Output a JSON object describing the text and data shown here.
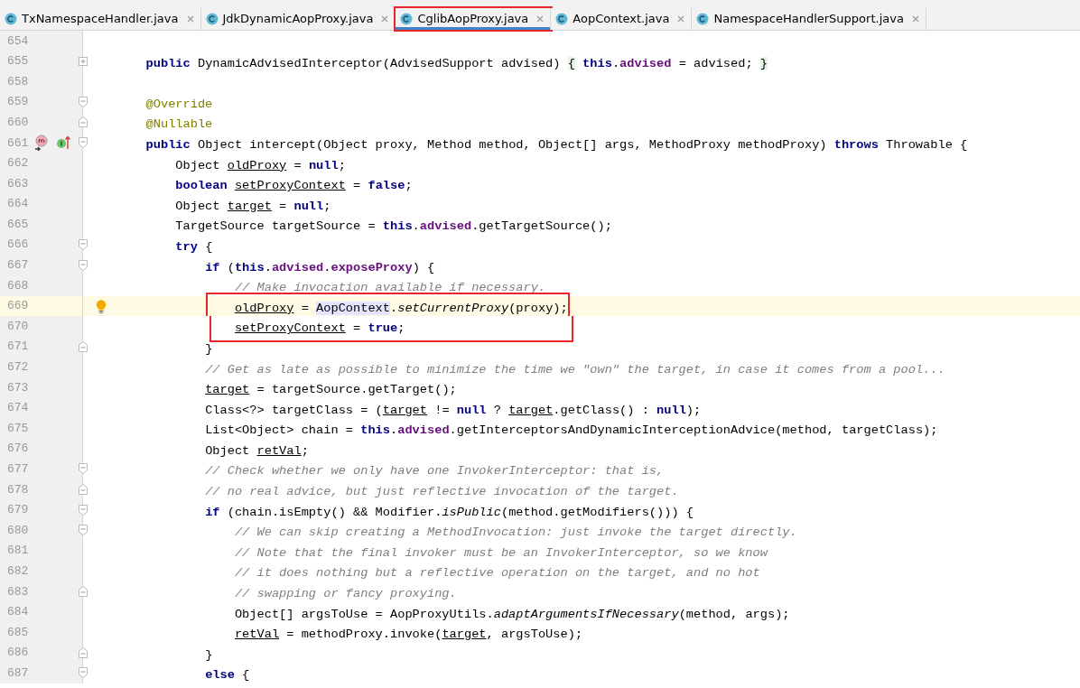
{
  "tabs": [
    {
      "label": "TxNamespaceHandler.java",
      "selected": false,
      "boxed": false
    },
    {
      "label": "JdkDynamicAopProxy.java",
      "selected": false,
      "boxed": false
    },
    {
      "label": "CglibAopProxy.java",
      "selected": true,
      "boxed": true
    },
    {
      "label": "AopContext.java",
      "selected": false,
      "boxed": false
    },
    {
      "label": "NamespaceHandlerSupport.java",
      "selected": false,
      "boxed": false
    }
  ],
  "editor": {
    "lines": [
      {
        "number": "654",
        "current": false,
        "boxed": false
      },
      {
        "number": "655",
        "current": false,
        "boxed": false,
        "gutter_icons": [
          {
            "kind": "collapsed"
          }
        ],
        "tokens": [
          {
            "kind": "keyword",
            "text": "        public"
          },
          {
            "kind": "plain",
            "text": " DynamicAdvisedInterceptor(AdvisedSupport advised) "
          },
          {
            "kind": "fold_brace",
            "text": "{"
          },
          {
            "kind": "keyword",
            "text": " this"
          },
          {
            "kind": "plain",
            "text": "."
          },
          {
            "kind": "field",
            "text": "advised"
          },
          {
            "kind": "plain",
            "text": " = advised; "
          },
          {
            "kind": "fold_brace",
            "text": "}"
          }
        ]
      },
      {
        "number": "658",
        "current": false,
        "boxed": false
      },
      {
        "number": "659",
        "current": false,
        "boxed": false,
        "gutter_icons": [
          {
            "kind": "fold_start"
          }
        ],
        "tokens": [
          {
            "kind": "annotation",
            "text": "        @Override"
          }
        ]
      },
      {
        "number": "660",
        "current": false,
        "boxed": false,
        "gutter_icons": [
          {
            "kind": "fold_end"
          }
        ],
        "tokens": [
          {
            "kind": "annotation",
            "text": "        @Nullable"
          }
        ]
      },
      {
        "number": "661",
        "current": false,
        "boxed": false,
        "gutter_icons": [
          {
            "kind": "method"
          },
          {
            "kind": "implements"
          },
          {
            "kind": "fold_start"
          }
        ],
        "tokens": [
          {
            "kind": "keyword",
            "text": "        public"
          },
          {
            "kind": "plain",
            "text": " Object intercept(Object proxy, Method method, Object[] args, MethodProxy methodProxy) "
          },
          {
            "kind": "keyword",
            "text": "throws"
          },
          {
            "kind": "plain",
            "text": " Throwable {"
          }
        ]
      },
      {
        "number": "662",
        "current": false,
        "boxed": false,
        "tokens": [
          {
            "kind": "plain",
            "text": "            Object "
          },
          {
            "kind": "local",
            "text": "oldProxy"
          },
          {
            "kind": "plain",
            "text": " = "
          },
          {
            "kind": "keyword",
            "text": "null"
          },
          {
            "kind": "plain",
            "text": ";"
          }
        ]
      },
      {
        "number": "663",
        "current": false,
        "boxed": false,
        "tokens": [
          {
            "kind": "keyword",
            "text": "            boolean "
          },
          {
            "kind": "local",
            "text": "setProxyContext"
          },
          {
            "kind": "plain",
            "text": " = "
          },
          {
            "kind": "keyword",
            "text": "false"
          },
          {
            "kind": "plain",
            "text": ";"
          }
        ]
      },
      {
        "number": "664",
        "current": false,
        "boxed": false,
        "tokens": [
          {
            "kind": "plain",
            "text": "            Object "
          },
          {
            "kind": "local",
            "text": "target"
          },
          {
            "kind": "plain",
            "text": " = "
          },
          {
            "kind": "keyword",
            "text": "null"
          },
          {
            "kind": "plain",
            "text": ";"
          }
        ]
      },
      {
        "number": "665",
        "current": false,
        "boxed": false,
        "tokens": [
          {
            "kind": "plain",
            "text": "            TargetSource targetSource = "
          },
          {
            "kind": "keyword",
            "text": "this"
          },
          {
            "kind": "plain",
            "text": "."
          },
          {
            "kind": "field",
            "text": "advised"
          },
          {
            "kind": "plain",
            "text": ".getTargetSource();"
          }
        ]
      },
      {
        "number": "666",
        "current": false,
        "boxed": false,
        "gutter_icons": [
          {
            "kind": "fold_start"
          }
        ],
        "tokens": [
          {
            "kind": "keyword",
            "text": "            try"
          },
          {
            "kind": "plain",
            "text": " {"
          }
        ]
      },
      {
        "number": "667",
        "current": false,
        "boxed": false,
        "gutter_icons": [
          {
            "kind": "fold_start"
          }
        ],
        "tokens": [
          {
            "kind": "keyword",
            "text": "                if"
          },
          {
            "kind": "plain",
            "text": " ("
          },
          {
            "kind": "keyword",
            "text": "this"
          },
          {
            "kind": "plain",
            "text": "."
          },
          {
            "kind": "field",
            "text": "advised"
          },
          {
            "kind": "plain",
            "text": "."
          },
          {
            "kind": "field",
            "text": "exposeProxy"
          },
          {
            "kind": "plain",
            "text": ") {"
          }
        ]
      },
      {
        "number": "668",
        "current": false,
        "boxed": false,
        "tokens": [
          {
            "kind": "comment",
            "text": "                    // Make invocation available if necessary."
          }
        ]
      },
      {
        "number": "669",
        "current": true,
        "boxed": true,
        "gutter_icons": [
          {
            "kind": "bulb"
          }
        ],
        "tokens": [
          {
            "kind": "local",
            "text": "                    oldProxy"
          },
          {
            "kind": "plain",
            "text": " = "
          },
          {
            "kind": "usage",
            "text": "AopContext"
          },
          {
            "kind": "plain",
            "text": "."
          },
          {
            "kind": "static",
            "text": "setCurrentProxy"
          },
          {
            "kind": "plain",
            "text": "(proxy);"
          }
        ]
      },
      {
        "number": "670",
        "current": false,
        "boxed": true,
        "tokens": [
          {
            "kind": "local",
            "text": "                    setProxyContext"
          },
          {
            "kind": "plain",
            "text": " = "
          },
          {
            "kind": "keyword",
            "text": "true"
          },
          {
            "kind": "plain",
            "text": ";"
          }
        ]
      },
      {
        "number": "671",
        "current": false,
        "boxed": false,
        "gutter_icons": [
          {
            "kind": "fold_end"
          }
        ],
        "tokens": [
          {
            "kind": "plain",
            "text": "                }"
          }
        ]
      },
      {
        "number": "672",
        "current": false,
        "boxed": false,
        "tokens": [
          {
            "kind": "comment",
            "text": "                // Get as late as possible to minimize the time we \"own\" the target, in case it comes from a pool..."
          }
        ]
      },
      {
        "number": "673",
        "current": false,
        "boxed": false,
        "tokens": [
          {
            "kind": "local",
            "text": "                target"
          },
          {
            "kind": "plain",
            "text": " = targetSource.getTarget();"
          }
        ]
      },
      {
        "number": "674",
        "current": false,
        "boxed": false,
        "tokens": [
          {
            "kind": "plain",
            "text": "                Class<?> targetClass = ("
          },
          {
            "kind": "local",
            "text": "target"
          },
          {
            "kind": "plain",
            "text": " != "
          },
          {
            "kind": "keyword",
            "text": "null"
          },
          {
            "kind": "plain",
            "text": " ? "
          },
          {
            "kind": "local",
            "text": "target"
          },
          {
            "kind": "plain",
            "text": ".getClass() : "
          },
          {
            "kind": "keyword",
            "text": "null"
          },
          {
            "kind": "plain",
            "text": ");"
          }
        ]
      },
      {
        "number": "675",
        "current": false,
        "boxed": false,
        "tokens": [
          {
            "kind": "plain",
            "text": "                List<Object> chain = "
          },
          {
            "kind": "keyword",
            "text": "this"
          },
          {
            "kind": "plain",
            "text": "."
          },
          {
            "kind": "field",
            "text": "advised"
          },
          {
            "kind": "plain",
            "text": ".getInterceptorsAndDynamicInterceptionAdvice(method, targetClass);"
          }
        ]
      },
      {
        "number": "676",
        "current": false,
        "boxed": false,
        "tokens": [
          {
            "kind": "plain",
            "text": "                Object "
          },
          {
            "kind": "local",
            "text": "retVal"
          },
          {
            "kind": "plain",
            "text": ";"
          }
        ]
      },
      {
        "number": "677",
        "current": false,
        "boxed": false,
        "gutter_icons": [
          {
            "kind": "fold_start"
          }
        ],
        "tokens": [
          {
            "kind": "comment",
            "text": "                // Check whether we only have one InvokerInterceptor: that is,"
          }
        ]
      },
      {
        "number": "678",
        "current": false,
        "boxed": false,
        "gutter_icons": [
          {
            "kind": "fold_end"
          }
        ],
        "tokens": [
          {
            "kind": "comment",
            "text": "                // no real advice, but just reflective invocation of the target."
          }
        ]
      },
      {
        "number": "679",
        "current": false,
        "boxed": false,
        "gutter_icons": [
          {
            "kind": "fold_start"
          }
        ],
        "tokens": [
          {
            "kind": "keyword",
            "text": "                if"
          },
          {
            "kind": "plain",
            "text": " (chain.isEmpty() && Modifier."
          },
          {
            "kind": "static",
            "text": "isPublic"
          },
          {
            "kind": "plain",
            "text": "(method.getModifiers())) {"
          }
        ]
      },
      {
        "number": "680",
        "current": false,
        "boxed": false,
        "gutter_icons": [
          {
            "kind": "fold_start"
          }
        ],
        "tokens": [
          {
            "kind": "comment",
            "text": "                    // We can skip creating a MethodInvocation: just invoke the target directly."
          }
        ]
      },
      {
        "number": "681",
        "current": false,
        "boxed": false,
        "tokens": [
          {
            "kind": "comment",
            "text": "                    // Note that the final invoker must be an InvokerInterceptor, so we know"
          }
        ]
      },
      {
        "number": "682",
        "current": false,
        "boxed": false,
        "tokens": [
          {
            "kind": "comment",
            "text": "                    // it does nothing but a reflective operation on the target, and no hot"
          }
        ]
      },
      {
        "number": "683",
        "current": false,
        "boxed": false,
        "gutter_icons": [
          {
            "kind": "fold_end"
          }
        ],
        "tokens": [
          {
            "kind": "comment",
            "text": "                    // swapping or fancy proxying."
          }
        ]
      },
      {
        "number": "684",
        "current": false,
        "boxed": false,
        "tokens": [
          {
            "kind": "plain",
            "text": "                    Object[] argsToUse = AopProxyUtils."
          },
          {
            "kind": "static",
            "text": "adaptArgumentsIfNecessary"
          },
          {
            "kind": "plain",
            "text": "(method, args);"
          }
        ]
      },
      {
        "number": "685",
        "current": false,
        "boxed": false,
        "tokens": [
          {
            "kind": "local",
            "text": "                    retVal"
          },
          {
            "kind": "plain",
            "text": " = methodProxy.invoke("
          },
          {
            "kind": "local",
            "text": "target"
          },
          {
            "kind": "plain",
            "text": ", argsToUse);"
          }
        ]
      },
      {
        "number": "686",
        "current": false,
        "boxed": false,
        "gutter_icons": [
          {
            "kind": "fold_end"
          }
        ],
        "tokens": [
          {
            "kind": "plain",
            "text": "                }"
          }
        ]
      },
      {
        "number": "687",
        "current": false,
        "boxed": false,
        "gutter_icons": [
          {
            "kind": "fold_start"
          }
        ],
        "tokens": [
          {
            "kind": "keyword",
            "text": "                else"
          },
          {
            "kind": "plain",
            "text": " {"
          }
        ]
      }
    ]
  }
}
